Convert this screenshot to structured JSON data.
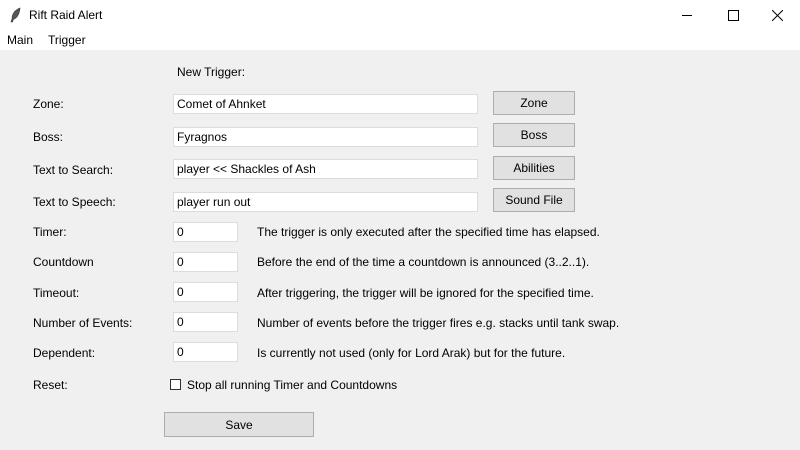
{
  "window": {
    "title": "Rift Raid Alert",
    "app_icon": "feather-icon",
    "controls": [
      "minimize-icon",
      "maximize-icon",
      "close-icon"
    ]
  },
  "menu": {
    "items": [
      {
        "label": "Main"
      },
      {
        "label": "Trigger"
      }
    ]
  },
  "form": {
    "heading": "New Trigger:",
    "zone": {
      "label": "Zone:",
      "value": "Comet of Ahnket",
      "button": "Zone"
    },
    "boss": {
      "label": "Boss:",
      "value": "Fyragnos",
      "button": "Boss"
    },
    "search": {
      "label": "Text to Search:",
      "value": "player << Shackles of Ash",
      "button": "Abilities"
    },
    "speech": {
      "label": "Text to Speech:",
      "value": "player run out",
      "button": "Sound File"
    },
    "timer": {
      "label": "Timer:",
      "value": "0",
      "description": "The trigger is only executed after the specified time has elapsed."
    },
    "countdown": {
      "label": "Countdown",
      "value": "0",
      "description": "Before the end of the time a countdown is announced (3..2..1)."
    },
    "timeout": {
      "label": "Timeout:",
      "value": "0",
      "description": "After triggering, the trigger will be ignored for the specified time."
    },
    "events": {
      "label": "Number of Events:",
      "value": "0",
      "description": "Number of events before the trigger fires e.g. stacks until tank swap."
    },
    "dependent": {
      "label": "Dependent:",
      "value": "0",
      "description": "Is currently not used (only for Lord Arak) but for the future."
    },
    "reset": {
      "label": "Reset:",
      "checkbox_label": "Stop all running Timer and Countdowns",
      "checked": false
    },
    "save_label": "Save"
  }
}
